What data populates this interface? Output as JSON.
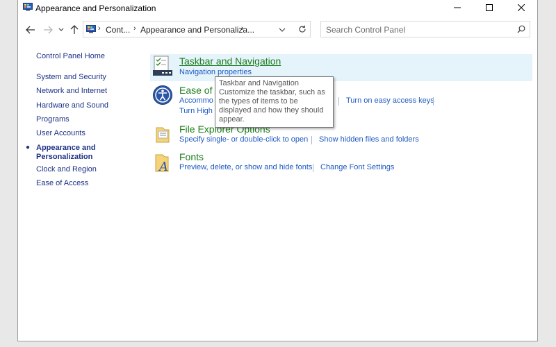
{
  "window": {
    "title": "Appearance and Personalization",
    "buttons": {
      "minimize": "minimize",
      "maximize": "maximize",
      "close": "close"
    }
  },
  "navbar": {
    "breadcrumbs": [
      "Cont...",
      "Appearance and Personaliza..."
    ],
    "search_placeholder": "Search Control Panel"
  },
  "sidebar": {
    "home": "Control Panel Home",
    "items": [
      {
        "label": "System and Security"
      },
      {
        "label": "Network and Internet"
      },
      {
        "label": "Hardware and Sound"
      },
      {
        "label": "Programs"
      },
      {
        "label": "User Accounts"
      },
      {
        "label": "Appearance and Personalization",
        "current": true
      },
      {
        "label": "Clock and Region"
      },
      {
        "label": "Ease of Access"
      }
    ],
    "current_label_lines": [
      "Appearance and",
      "Personalization"
    ]
  },
  "categories": [
    {
      "title": "Taskbar and Navigation",
      "icon": "taskbar-icon",
      "tasks": [
        "Navigation properties"
      ]
    },
    {
      "title": "Ease of A",
      "icon": "ease-of-access-icon",
      "tasks": [
        "Accommo",
        "Turn on easy access keys",
        "Turn High"
      ]
    },
    {
      "title": "File Explorer Options",
      "icon": "file-explorer-options-icon",
      "tasks": [
        "Specify single- or double-click to open",
        "Show hidden files and folders"
      ]
    },
    {
      "title": "Fonts",
      "icon": "fonts-icon",
      "tasks": [
        "Preview, delete, or show and hide fonts",
        "Change Font Settings"
      ]
    }
  ],
  "tooltip": {
    "title": "Taskbar and Navigation",
    "body": "Customize the taskbar, such as the types of items to be displayed and how they should appear."
  },
  "colors": {
    "category_title": "#1a7d1a",
    "task_link": "#1d59c2",
    "nav_link": "#1e3287",
    "highlight": "#e5f3fb"
  }
}
